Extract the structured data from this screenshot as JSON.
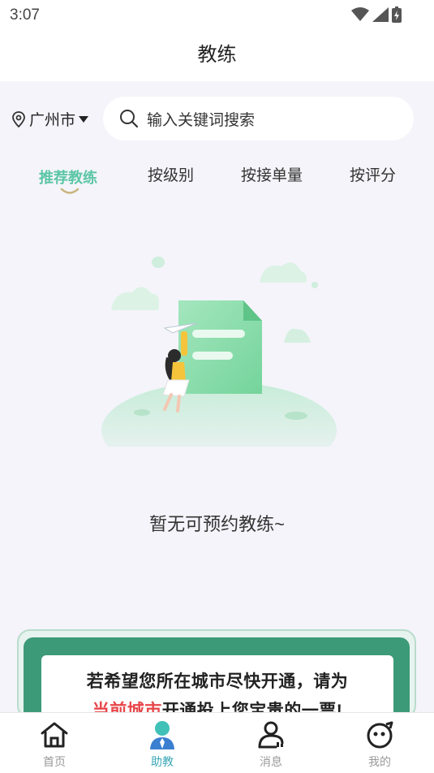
{
  "status": {
    "time": "3:07"
  },
  "header": {
    "title": "教练"
  },
  "search": {
    "city": "广州市",
    "placeholder": "输入关键词搜索"
  },
  "tabs": [
    {
      "label": "推荐教练",
      "active": true
    },
    {
      "label": "按级别",
      "active": false
    },
    {
      "label": "按接单量",
      "active": false
    },
    {
      "label": "按评分",
      "active": false
    }
  ],
  "empty_state": {
    "message": "暂无可预约教练~"
  },
  "banner": {
    "line1": "若希望您所在城市尽快开通，请为",
    "line2_highlight": "当前城市",
    "line2_rest": "开通投上您宝贵的一票!"
  },
  "nav": [
    {
      "label": "首页",
      "icon": "home-icon",
      "active": false
    },
    {
      "label": "助教",
      "icon": "coach-icon",
      "active": true
    },
    {
      "label": "消息",
      "icon": "message-icon",
      "active": false
    },
    {
      "label": "我的",
      "icon": "profile-icon",
      "active": false
    }
  ],
  "colors": {
    "accent_green": "#5cc6a6",
    "nav_active": "#3aa7b8",
    "highlight_red": "#e8464a",
    "background": "#f4f4fa"
  }
}
